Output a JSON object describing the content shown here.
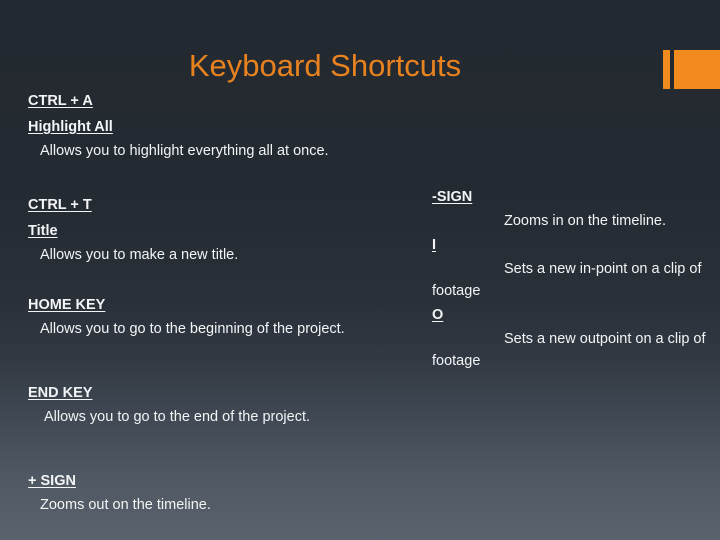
{
  "slide": {
    "title": "Keyboard Shortcuts",
    "accent_color": "#e8821e",
    "background_top_color": "#242a31",
    "background_bottom_color": "#5a636d",
    "text_color": "#f2f4f6"
  },
  "left_column": [
    {
      "keys": "CTRL + A",
      "action": "Highlight All",
      "description": "Allows you to highlight everything all at once."
    },
    {
      "keys": "CTRL + T",
      "action": "Title",
      "description": "Allows you to make a new title."
    },
    {
      "keys": "HOME KEY",
      "description": "Allows you to go to the beginning of the project."
    },
    {
      "keys": "END KEY",
      "description": "Allows you to go to the end of the project."
    },
    {
      "keys": "+ SIGN",
      "description": "Zooms out on the timeline."
    }
  ],
  "right_column": [
    {
      "keys": "-SIGN",
      "description": "Zooms in on the timeline."
    },
    {
      "keys": "I",
      "description": "Sets a new in-point on a clip of footage"
    },
    {
      "keys": "O",
      "description": "Sets a new outpoint on a clip of footage"
    }
  ]
}
